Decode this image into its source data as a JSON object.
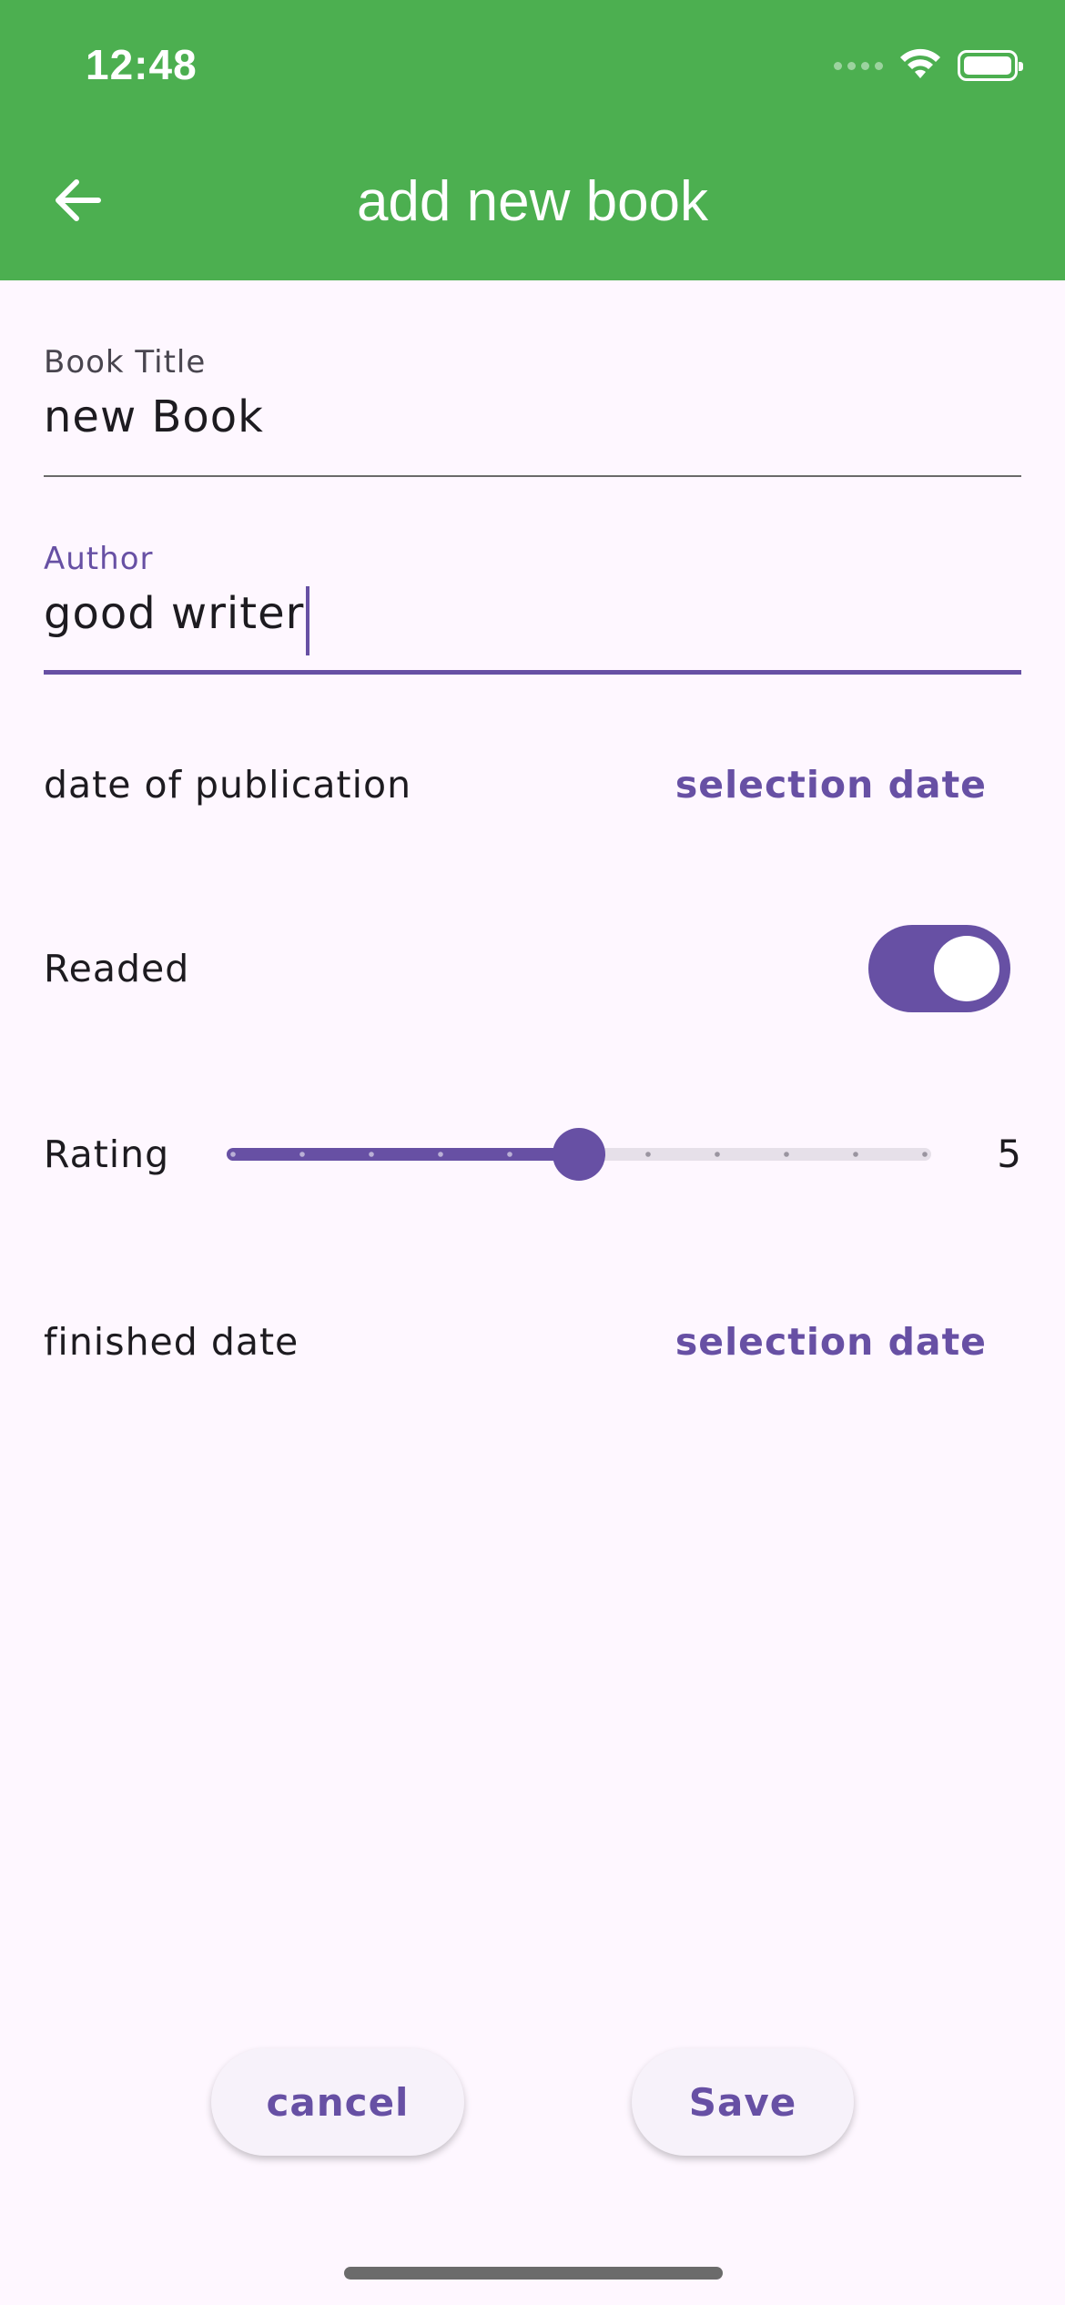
{
  "status_bar": {
    "time": "12:48"
  },
  "app_bar": {
    "title": "add new book",
    "back_icon": "arrow-left-icon"
  },
  "form": {
    "book_title": {
      "label": "Book Title",
      "value": "new Book"
    },
    "author": {
      "label": "Author",
      "value": "good writer"
    },
    "publication": {
      "label": "date of publication",
      "action": "selection date"
    },
    "readed": {
      "label": "Readed",
      "on": true
    },
    "rating": {
      "label": "Rating",
      "value": "5",
      "min": 0,
      "max": 10,
      "divisions": 10
    },
    "finished": {
      "label": "finished date",
      "action": "selection date"
    }
  },
  "actions": {
    "cancel": "cancel",
    "save": "Save"
  },
  "colors": {
    "app_bar": "#4CAF50",
    "primary": "#6750A4",
    "background": "#FEF7FF"
  }
}
